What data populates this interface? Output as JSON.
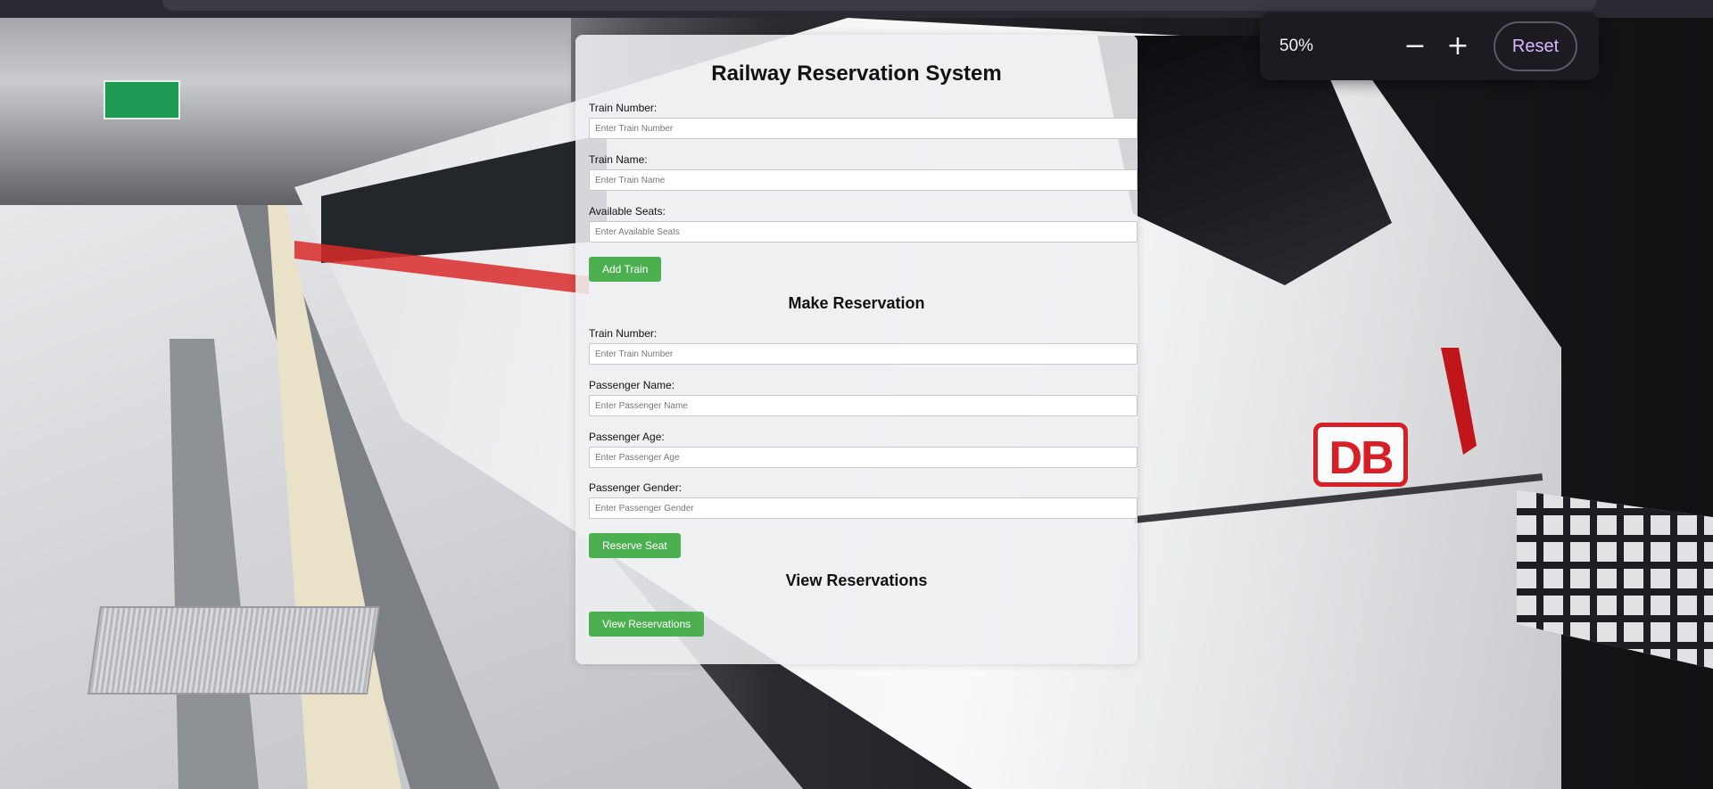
{
  "zoom": {
    "value": "50%",
    "minus_symbol": "−",
    "plus_symbol": "+",
    "reset_label": "Reset"
  },
  "train_logo_text": "DB",
  "form": {
    "title": "Railway Reservation System",
    "add_train": {
      "train_number_label": "Train Number:",
      "train_number_placeholder": "Enter Train Number",
      "train_name_label": "Train Name:",
      "train_name_placeholder": "Enter Train Name",
      "seats_label": "Available Seats:",
      "seats_placeholder": "Enter Available Seats",
      "button": "Add Train"
    },
    "reservation": {
      "heading": "Make Reservation",
      "train_number_label": "Train Number:",
      "train_number_placeholder": "Enter Train Number",
      "passenger_name_label": "Passenger Name:",
      "passenger_name_placeholder": "Enter Passenger Name",
      "passenger_age_label": "Passenger Age:",
      "passenger_age_placeholder": "Enter Passenger Age",
      "passenger_gender_label": "Passenger Gender:",
      "passenger_gender_placeholder": "Enter Passenger Gender",
      "button": "Reserve Seat"
    },
    "view": {
      "heading": "View Reservations",
      "button": "View Reservations"
    }
  },
  "colors": {
    "button_green": "#4caf50",
    "reset_text": "#d8b8ff",
    "db_red": "#d61f26"
  }
}
